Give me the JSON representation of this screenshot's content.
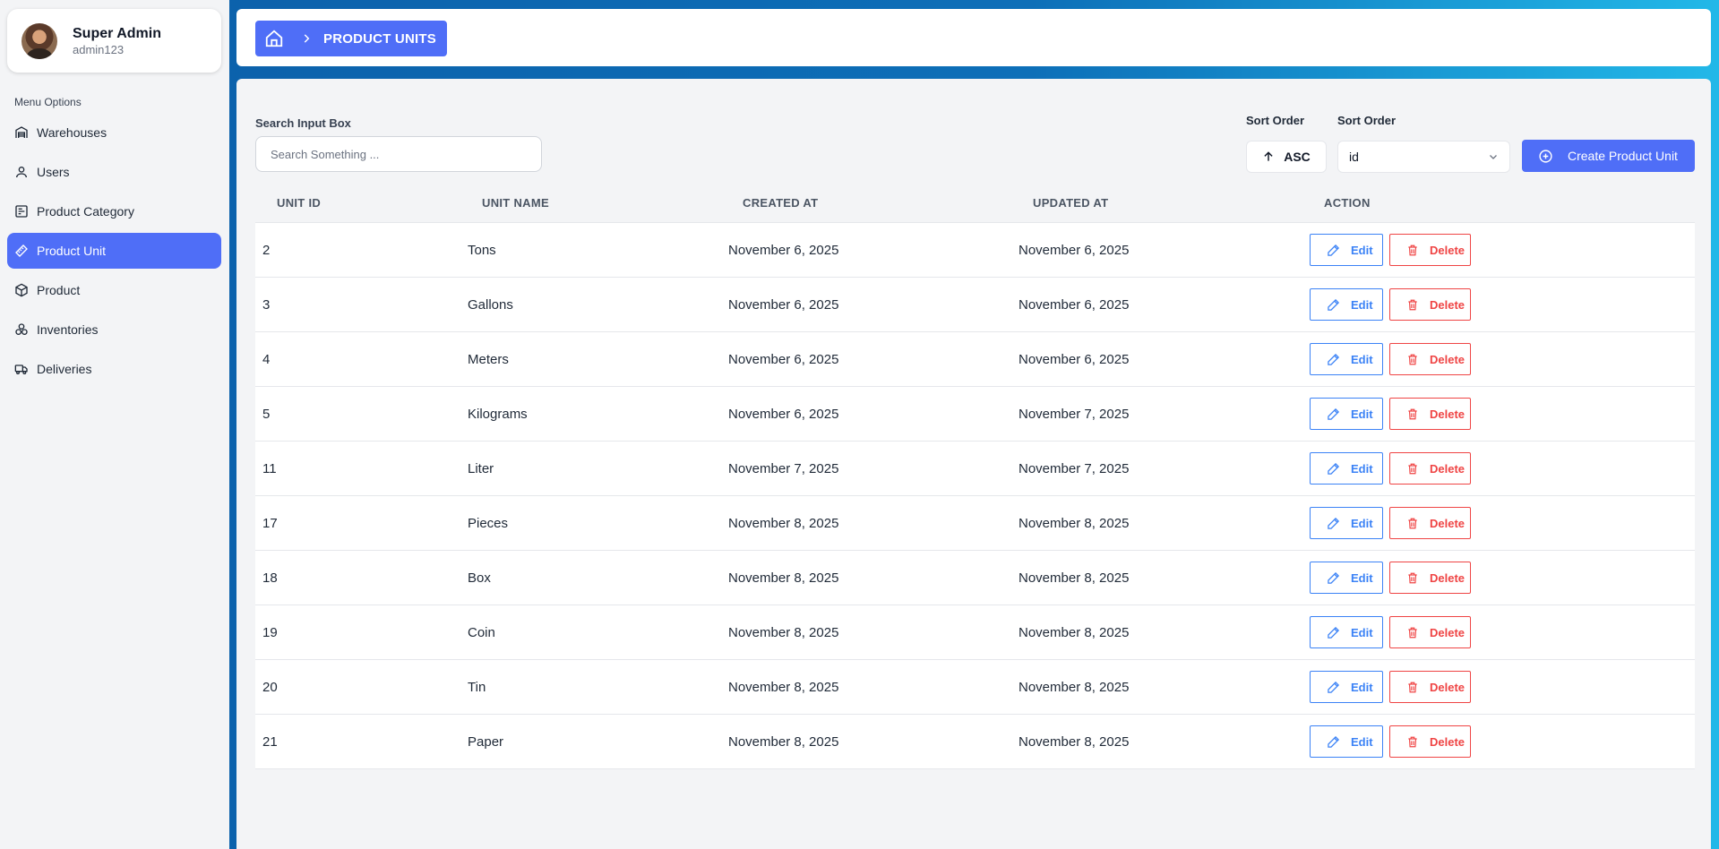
{
  "profile": {
    "name": "Super Admin",
    "username": "admin123"
  },
  "sidebar": {
    "heading": "Menu Options",
    "items": [
      {
        "label": "Warehouses",
        "icon": "warehouse-icon"
      },
      {
        "label": "Users",
        "icon": "user-icon"
      },
      {
        "label": "Product Category",
        "icon": "category-icon"
      },
      {
        "label": "Product Unit",
        "icon": "ruler-icon",
        "active": true
      },
      {
        "label": "Product",
        "icon": "box-icon"
      },
      {
        "label": "Inventories",
        "icon": "inventory-icon"
      },
      {
        "label": "Deliveries",
        "icon": "truck-icon"
      }
    ]
  },
  "breadcrumb": {
    "title": "PRODUCT UNITS"
  },
  "search": {
    "label": "Search Input Box",
    "placeholder": "Search Something ..."
  },
  "sort": {
    "direction_label": "Sort Order",
    "field_label": "Sort Order",
    "direction_value": "ASC",
    "field_value": "id"
  },
  "create_button": {
    "label": "Create Product Unit"
  },
  "table": {
    "columns": [
      "UNIT ID",
      "UNIT NAME",
      "CREATED AT",
      "UPDATED AT",
      "ACTION"
    ],
    "edit_label": "Edit",
    "delete_label": "Delete",
    "rows": [
      {
        "id": "2",
        "name": "Tons",
        "created": "November 6, 2025",
        "updated": "November 6, 2025"
      },
      {
        "id": "3",
        "name": "Gallons",
        "created": "November 6, 2025",
        "updated": "November 6, 2025"
      },
      {
        "id": "4",
        "name": "Meters",
        "created": "November 6, 2025",
        "updated": "November 6, 2025"
      },
      {
        "id": "5",
        "name": "Kilograms",
        "created": "November 6, 2025",
        "updated": "November 7, 2025"
      },
      {
        "id": "11",
        "name": "Liter",
        "created": "November 7, 2025",
        "updated": "November 7, 2025"
      },
      {
        "id": "17",
        "name": "Pieces",
        "created": "November 8, 2025",
        "updated": "November 8, 2025"
      },
      {
        "id": "18",
        "name": "Box",
        "created": "November 8, 2025",
        "updated": "November 8, 2025"
      },
      {
        "id": "19",
        "name": "Coin",
        "created": "November 8, 2025",
        "updated": "November 8, 2025"
      },
      {
        "id": "20",
        "name": "Tin",
        "created": "November 8, 2025",
        "updated": "November 8, 2025"
      },
      {
        "id": "21",
        "name": "Paper",
        "created": "November 8, 2025",
        "updated": "November 8, 2025"
      }
    ]
  },
  "colors": {
    "accent": "#4f6ef7",
    "edit": "#3b82f6",
    "delete": "#ef4444",
    "header_gradient_start": "#0b5ea8",
    "header_gradient_end": "#22b8e8"
  }
}
